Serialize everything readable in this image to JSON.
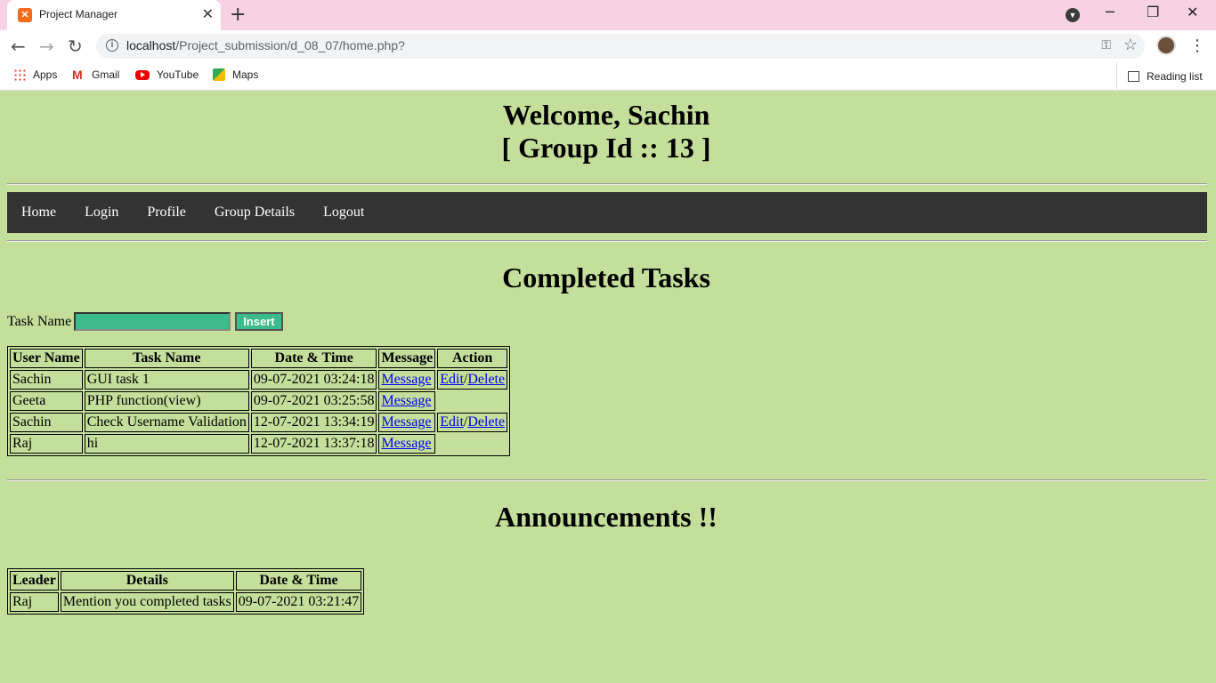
{
  "browser": {
    "tab_title": "Project Manager",
    "url_host": "localhost",
    "url_path": "/Project_submission/d_08_07/home.php?",
    "bookmarks": [
      {
        "label": "Apps"
      },
      {
        "label": "Gmail"
      },
      {
        "label": "YouTube"
      },
      {
        "label": "Maps"
      }
    ],
    "reading_list": "Reading list"
  },
  "header": {
    "welcome": "Welcome, Sachin",
    "group": "[ Group Id :: 13 ]"
  },
  "nav": [
    "Home",
    "Login",
    "Profile",
    "Group Details",
    "Logout"
  ],
  "completed": {
    "title": "Completed Tasks",
    "task_label": "Task Name",
    "task_value": "",
    "insert_label": "Insert",
    "headers": [
      "User Name",
      "Task Name",
      "Date & Time",
      "Message",
      "Action"
    ],
    "rows": [
      {
        "user": "Sachin",
        "task": "GUI task 1",
        "datetime": "09-07-2021 03:24:18",
        "message": "Message",
        "edit": "Edit",
        "sep": "/",
        "delete": "Delete"
      },
      {
        "user": "Geeta",
        "task": "PHP function(view)",
        "datetime": "09-07-2021 03:25:58",
        "message": "Message"
      },
      {
        "user": "Sachin",
        "task": "Check Username Validation",
        "datetime": "12-07-2021 13:34:19",
        "message": "Message",
        "edit": "Edit",
        "sep": "/",
        "delete": "Delete"
      },
      {
        "user": "Raj",
        "task": "hi",
        "datetime": "12-07-2021 13:37:18",
        "message": "Message"
      }
    ]
  },
  "announcements": {
    "title": "Announcements !!",
    "headers": [
      "Leader",
      "Details",
      "Date & Time"
    ],
    "rows": [
      {
        "leader": "Raj",
        "details": "Mention you completed tasks",
        "datetime": "09-07-2021 03:21:47"
      }
    ]
  },
  "colors": {
    "page_bg": "#c4df9b",
    "nav_bg": "#333333",
    "input_bg": "#3cbc8d",
    "tab_strip": "#f6d2e2"
  }
}
